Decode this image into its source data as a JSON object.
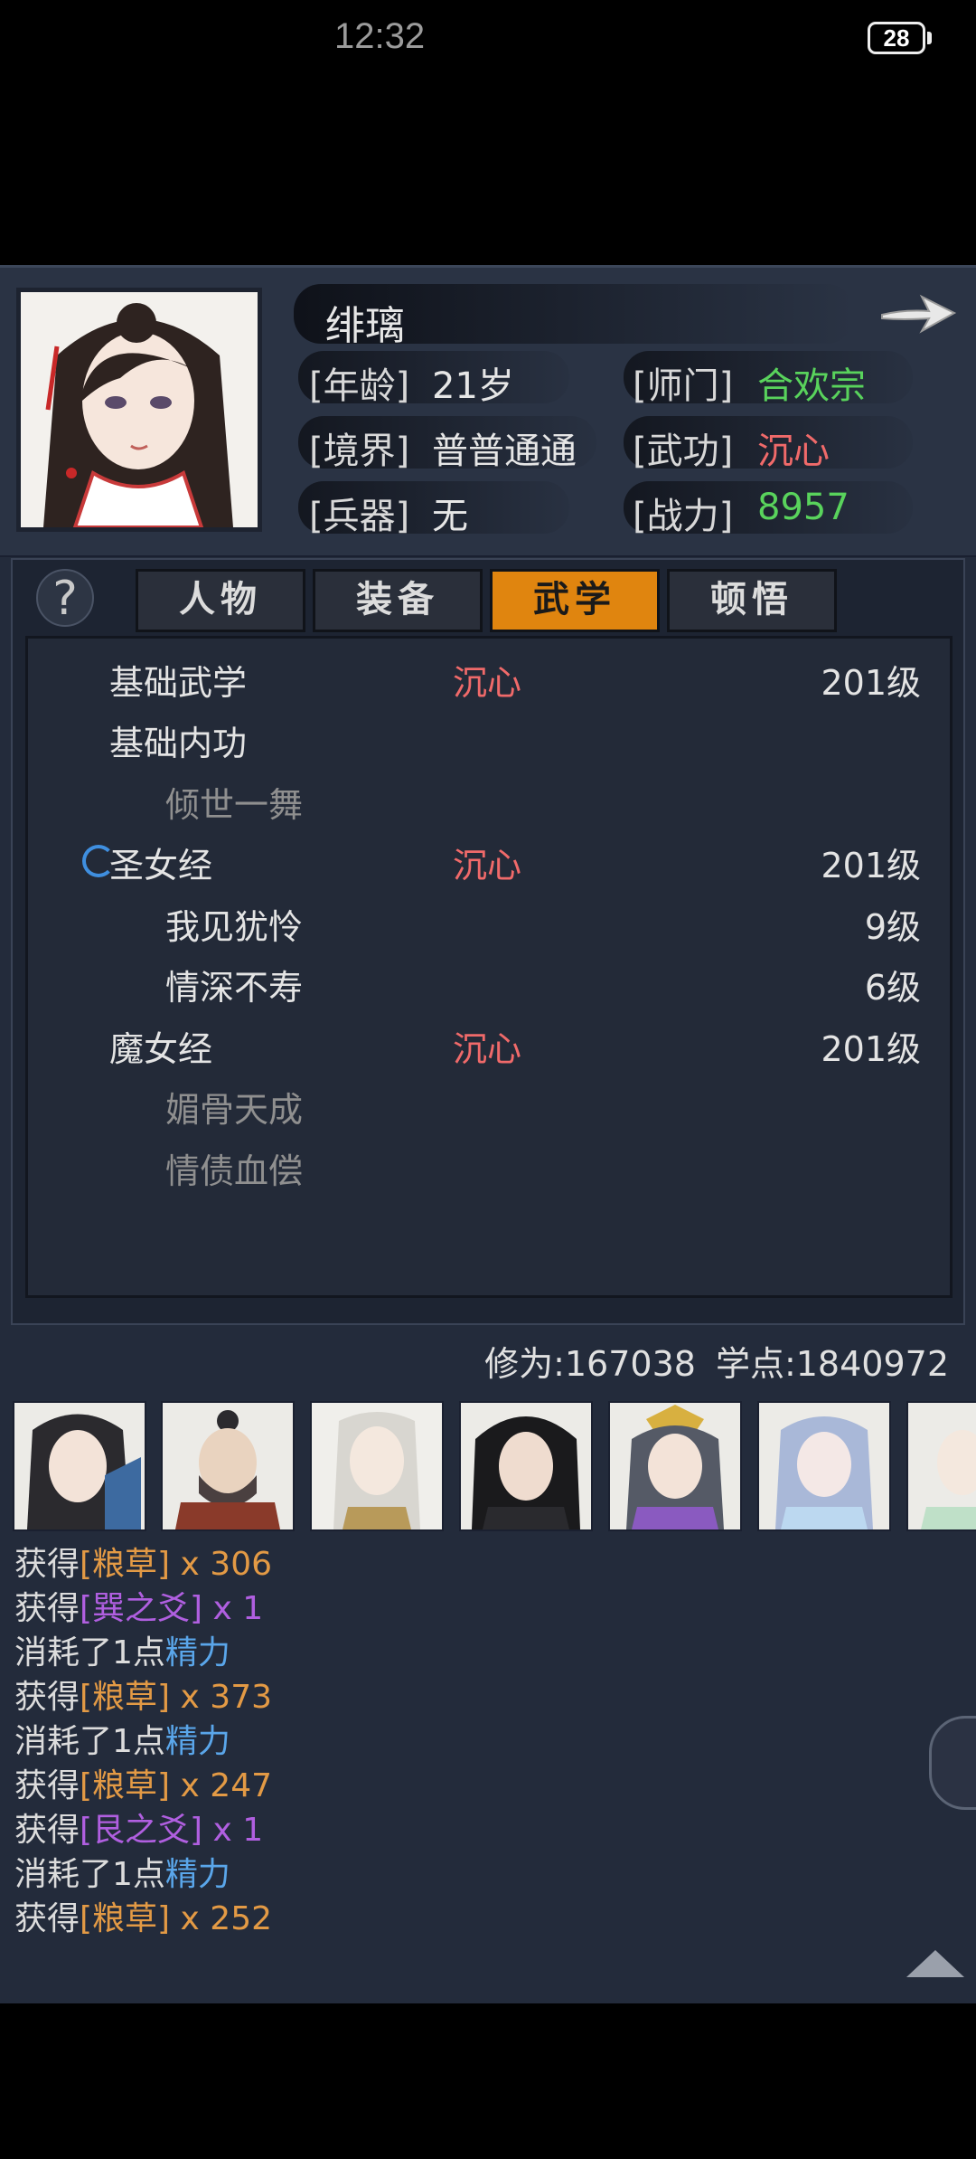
{
  "status_bar": {
    "time": "12:32",
    "battery": "28"
  },
  "header": {
    "name": "绯璃",
    "stats": [
      {
        "label": "[年龄]",
        "value": "21岁"
      },
      {
        "label": "[师门]",
        "value": "合欢宗"
      },
      {
        "label": "[境界]",
        "value": "普普通通"
      },
      {
        "label": "[武功]",
        "value": "沉心"
      },
      {
        "label": "[兵器]",
        "value": "无"
      },
      {
        "label": "[战力]",
        "value": "8957"
      }
    ]
  },
  "help_glyph": "?",
  "tabs": [
    {
      "label": "人物"
    },
    {
      "label": "装备"
    },
    {
      "label": "武学"
    },
    {
      "label": "顿悟"
    }
  ],
  "skills": [
    {
      "name": "基础武学",
      "status": "沉心",
      "level": "201级"
    },
    {
      "name": "基础内功",
      "status": "",
      "level": ""
    },
    {
      "name": "倾世一舞",
      "status": "",
      "level": ""
    },
    {
      "name": "圣女经",
      "status": "沉心",
      "level": "201级"
    },
    {
      "name": "我见犹怜",
      "status": "",
      "level": "9级"
    },
    {
      "name": "情深不寿",
      "status": "",
      "level": "6级"
    },
    {
      "name": "魔女经",
      "status": "沉心",
      "level": "201级"
    },
    {
      "name": "媚骨天成",
      "status": "",
      "level": ""
    },
    {
      "name": "情债血偿",
      "status": "",
      "level": ""
    }
  ],
  "footer": {
    "xiuwei": "修为:167038",
    "xuedian": "学点:1840972"
  },
  "log": [
    {
      "prefix": "获得",
      "item": "[粮草]",
      "suffix": " x 306"
    },
    {
      "prefix": "获得",
      "item": "[巽之爻]",
      "suffix": " x 1"
    },
    {
      "prefix": "消耗了1点",
      "item": "精力",
      "suffix": ""
    },
    {
      "prefix": "获得",
      "item": "[粮草]",
      "suffix": " x 373"
    },
    {
      "prefix": "消耗了1点",
      "item": "精力",
      "suffix": ""
    },
    {
      "prefix": "获得",
      "item": "[粮草]",
      "suffix": " x 247"
    },
    {
      "prefix": "获得",
      "item": "[艮之爻]",
      "suffix": " x 1"
    },
    {
      "prefix": "消耗了1点",
      "item": "精力",
      "suffix": ""
    },
    {
      "prefix": "获得",
      "item": "[粮草]",
      "suffix": " x 252"
    }
  ],
  "colors": {
    "accent_tab": "#e0850f",
    "green": "#59d35c",
    "red": "#f06a6a",
    "orange": "#e39a45",
    "purple": "#b05fe0",
    "blue": "#5aa6ea"
  }
}
